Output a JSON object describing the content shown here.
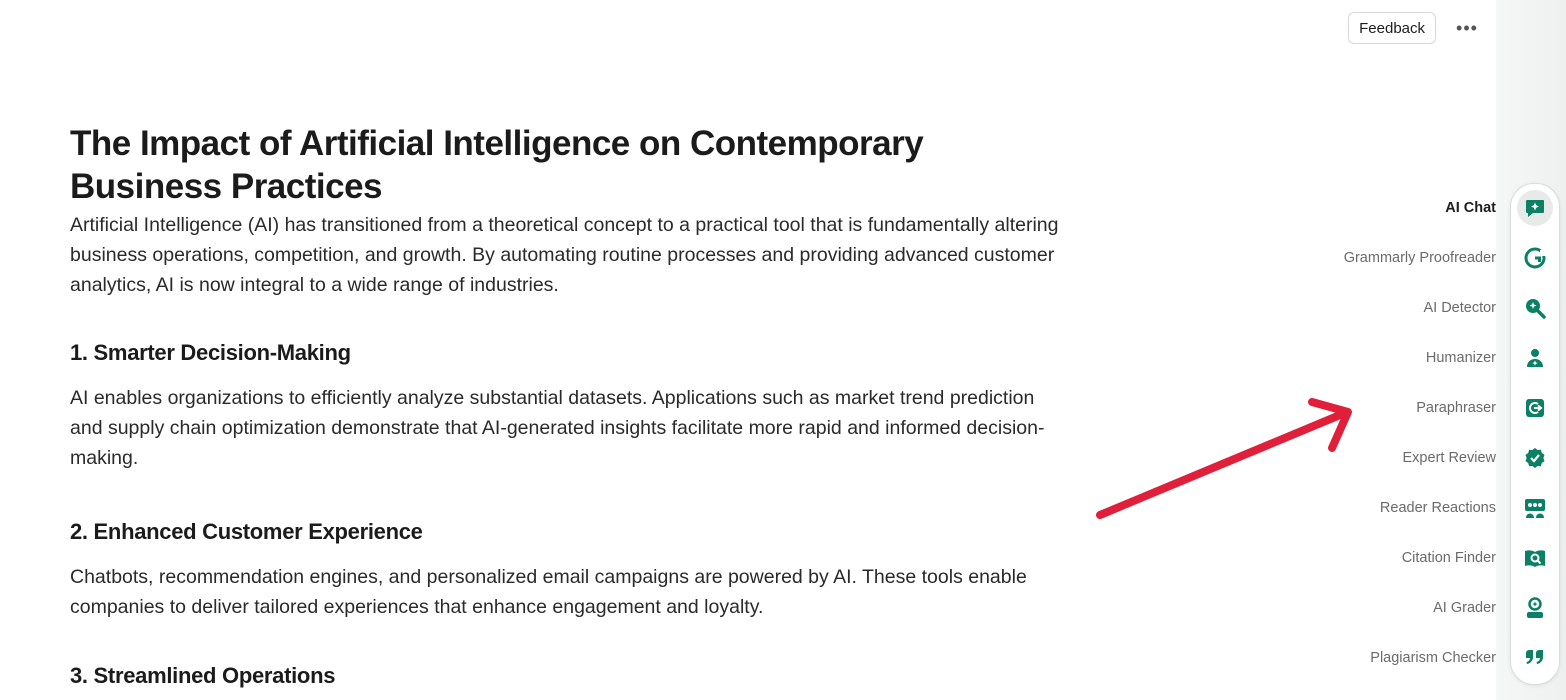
{
  "topbar": {
    "feedback_label": "Feedback",
    "more_label": "•••"
  },
  "document": {
    "title": "The Impact of Artificial Intelligence on Contemporary Business Practices",
    "intro": "Artificial Intelligence (AI) has transitioned from a theoretical concept to a practical tool that is fundamentally altering business operations, competition, and growth. By automating routine processes and providing advanced customer analytics, AI is now integral to a wide range of industries.",
    "sections": [
      {
        "heading": "1. Smarter Decision-Making",
        "body": "AI enables organizations to efficiently analyze substantial datasets. Applications such as market trend prediction and supply chain optimization demonstrate that AI-generated insights facilitate more rapid and informed decision-making."
      },
      {
        "heading": "2. Enhanced Customer Experience",
        "body": "Chatbots, recommendation engines, and personalized email campaigns are powered by AI. These tools enable companies to deliver tailored experiences that enhance engagement and loyalty."
      },
      {
        "heading": "3. Streamlined Operations"
      }
    ]
  },
  "sidebar": {
    "accent_color": "#0b8065",
    "arrow_color": "#e0203a",
    "items": [
      {
        "label": "AI Chat",
        "icon": "ai-chat-icon",
        "active": true
      },
      {
        "label": "Grammarly Proofreader",
        "icon": "grammarly-icon",
        "active": false
      },
      {
        "label": "AI Detector",
        "icon": "ai-detector-icon",
        "active": false
      },
      {
        "label": "Humanizer",
        "icon": "humanizer-icon",
        "active": false
      },
      {
        "label": "Paraphraser",
        "icon": "paraphraser-icon",
        "active": false
      },
      {
        "label": "Expert Review",
        "icon": "expert-review-icon",
        "active": false
      },
      {
        "label": "Reader Reactions",
        "icon": "reader-reactions-icon",
        "active": false
      },
      {
        "label": "Citation Finder",
        "icon": "citation-finder-icon",
        "active": false
      },
      {
        "label": "AI Grader",
        "icon": "ai-grader-icon",
        "active": false
      },
      {
        "label": "Plagiarism Checker",
        "icon": "plagiarism-checker-icon",
        "active": false
      }
    ]
  }
}
